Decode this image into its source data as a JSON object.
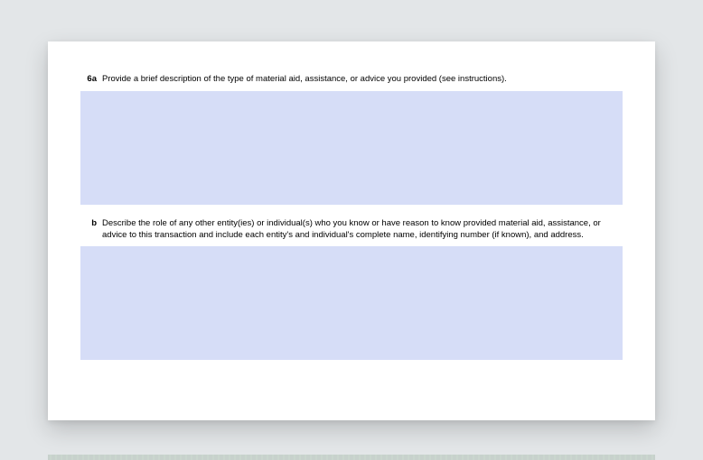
{
  "form": {
    "questions": [
      {
        "number": "6a",
        "prompt": "Provide a brief description of the type of material aid, assistance, or advice you provided (see instructions).",
        "value": ""
      },
      {
        "number": "b",
        "prompt": "Describe the role of any other entity(ies) or individual(s) who you know or have reason to know provided material aid, assistance, or advice to this transaction and include each entity's and individual's complete name, identifying number (if known), and address.",
        "value": ""
      }
    ]
  }
}
